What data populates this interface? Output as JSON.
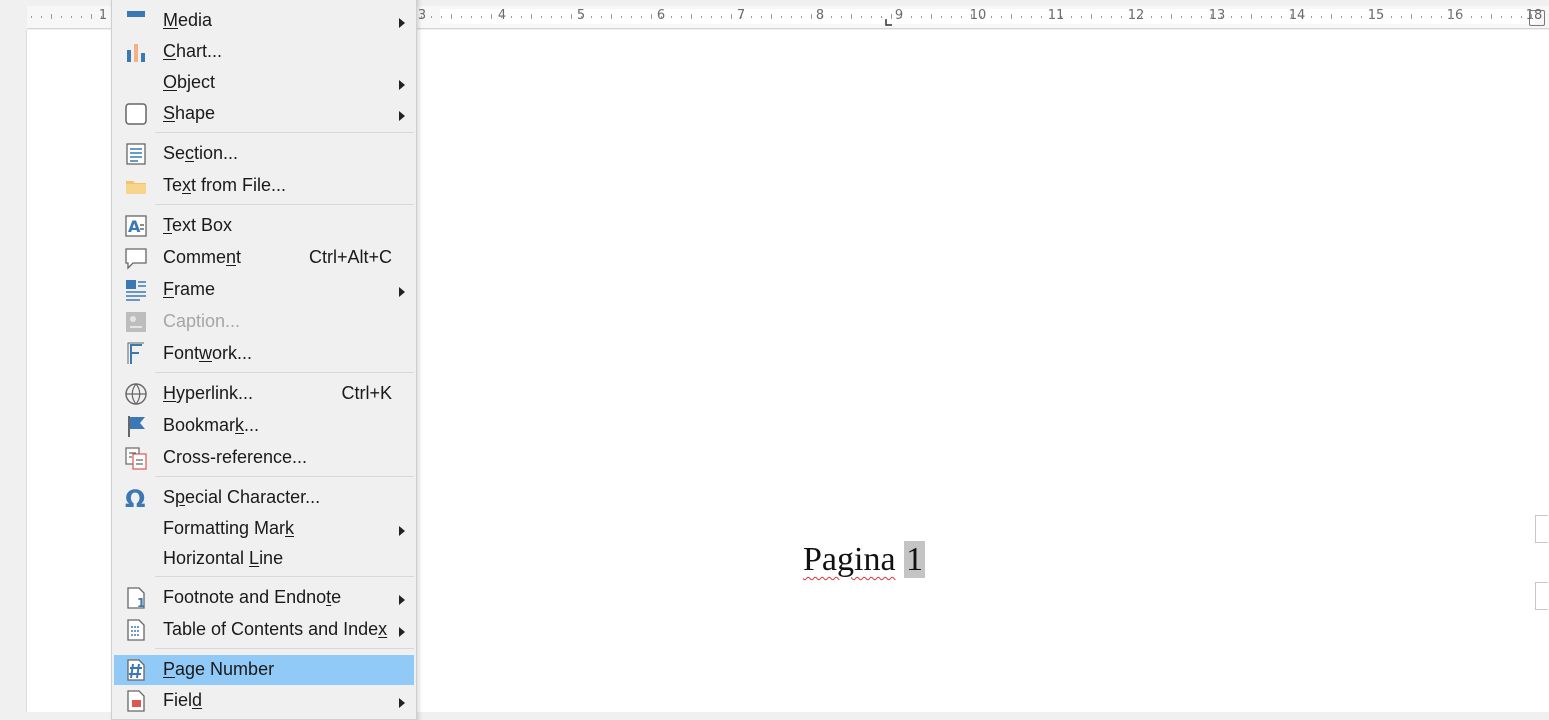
{
  "ruler": {
    "numbers": [
      "1",
      "3",
      "4",
      "5",
      "6",
      "7",
      "8",
      "9",
      "10",
      "11",
      "12",
      "13",
      "14",
      "15",
      "16",
      "18"
    ]
  },
  "document": {
    "word": "Pagina",
    "field": "1"
  },
  "menu": {
    "items": [
      {
        "pre": "",
        "u": "M",
        "post": "edia",
        "shortcut": "",
        "submenu": true,
        "icon": "media-icon",
        "state": "normal"
      },
      {
        "pre": "",
        "u": "C",
        "post": "hart...",
        "shortcut": "",
        "submenu": false,
        "icon": "chart-icon",
        "state": "normal"
      },
      {
        "pre": "",
        "u": "O",
        "post": "bject",
        "shortcut": "",
        "submenu": true,
        "icon": "",
        "state": "normal"
      },
      {
        "pre": "",
        "u": "S",
        "post": "hape",
        "shortcut": "",
        "submenu": true,
        "icon": "shape-icon",
        "state": "normal"
      },
      {
        "pre": "Se",
        "u": "c",
        "post": "tion...",
        "shortcut": "",
        "submenu": false,
        "icon": "section-icon",
        "state": "normal"
      },
      {
        "pre": "Te",
        "u": "x",
        "post": "t from File...",
        "shortcut": "",
        "submenu": false,
        "icon": "folder-icon",
        "state": "normal"
      },
      {
        "pre": "",
        "u": "T",
        "post": "ext Box",
        "shortcut": "",
        "submenu": false,
        "icon": "text-box-icon",
        "state": "normal"
      },
      {
        "pre": "Comme",
        "u": "n",
        "post": "t",
        "shortcut": "Ctrl+Alt+C",
        "submenu": false,
        "icon": "comment-icon",
        "state": "normal"
      },
      {
        "pre": "",
        "u": "F",
        "post": "rame",
        "shortcut": "",
        "submenu": true,
        "icon": "frame-icon",
        "state": "normal"
      },
      {
        "pre": "",
        "u": "",
        "post": "Caption...",
        "shortcut": "",
        "submenu": false,
        "icon": "caption-icon",
        "state": "disabled"
      },
      {
        "pre": "Font",
        "u": "w",
        "post": "ork...",
        "shortcut": "",
        "submenu": false,
        "icon": "fontwork-icon",
        "state": "normal"
      },
      {
        "pre": "",
        "u": "H",
        "post": "yperlink...",
        "shortcut": "Ctrl+K",
        "submenu": false,
        "icon": "hyperlink-icon",
        "state": "normal"
      },
      {
        "pre": "Bookmar",
        "u": "k",
        "post": "...",
        "shortcut": "",
        "submenu": false,
        "icon": "bookmark-icon",
        "state": "normal"
      },
      {
        "pre": "Cross-reference...",
        "u": "",
        "post": "",
        "shortcut": "",
        "submenu": false,
        "icon": "cross-reference-icon",
        "state": "normal"
      },
      {
        "pre": "S",
        "u": "p",
        "post": "ecial Character...",
        "shortcut": "",
        "submenu": false,
        "icon": "omega-icon",
        "state": "normal"
      },
      {
        "pre": "Formatting Mar",
        "u": "k",
        "post": "",
        "shortcut": "",
        "submenu": true,
        "icon": "",
        "state": "normal"
      },
      {
        "pre": "Horizontal ",
        "u": "L",
        "post": "ine",
        "shortcut": "",
        "submenu": false,
        "icon": "",
        "state": "normal"
      },
      {
        "pre": "Footnote and Endno",
        "u": "t",
        "post": "e",
        "shortcut": "",
        "submenu": true,
        "icon": "footnote-icon",
        "state": "normal"
      },
      {
        "pre": "Table of Contents and Inde",
        "u": "x",
        "post": "",
        "shortcut": "",
        "submenu": true,
        "icon": "toc-icon",
        "state": "normal"
      },
      {
        "pre": "",
        "u": "P",
        "post": "age Number",
        "shortcut": "",
        "submenu": false,
        "icon": "page-number-icon",
        "state": "selected"
      },
      {
        "pre": "Fiel",
        "u": "d",
        "post": "",
        "shortcut": "",
        "submenu": true,
        "icon": "field-icon",
        "state": "normal"
      }
    ]
  },
  "colors": {
    "menu_bg": "#f0f0f0",
    "highlight": "#91c9f7",
    "icon_blue": "#3c78b4",
    "folder": "#f3c56a",
    "chart_orange": "#f4b183",
    "field_bg": "#c4c4c4"
  }
}
